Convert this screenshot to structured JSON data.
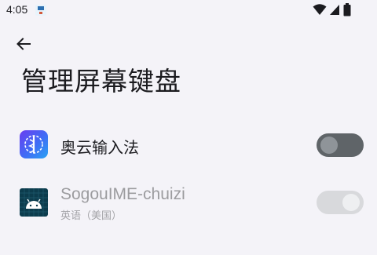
{
  "status_bar": {
    "time": "4:05"
  },
  "header": {
    "title": "管理屏幕键盘"
  },
  "keyboards": [
    {
      "name": "奥云输入法",
      "subtitle": "",
      "enabled": false,
      "icon": "aoyun-app-icon"
    },
    {
      "name": "SogouIME-chuizi",
      "subtitle": "英语（美国）",
      "enabled": true,
      "disabled_row": true,
      "icon": "android-app-icon"
    }
  ],
  "colors": {
    "background": "#f4f3f8",
    "toggle_off_track": "#5f6468",
    "toggle_disabled_track": "#d8d9dc"
  }
}
